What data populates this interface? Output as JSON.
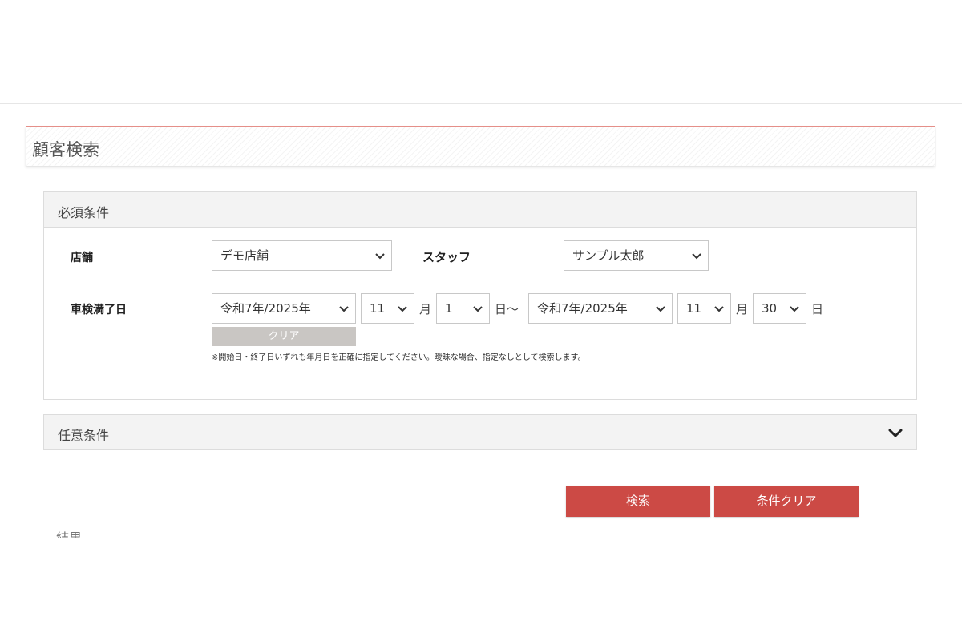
{
  "page": {
    "title": "顧客検索"
  },
  "required": {
    "title": "必須条件",
    "store_label": "店舗",
    "store_value": "デモ店舗",
    "staff_label": "スタッフ",
    "staff_value": "サンプル太郎",
    "date_label": "車検満了日",
    "from": {
      "era": "令和7年/2025年",
      "month": "11",
      "day": "1"
    },
    "to": {
      "era": "令和7年/2025年",
      "month": "11",
      "day": "30"
    },
    "month_unit": "月",
    "day_unit": "日",
    "range_sep": "日～",
    "clear_small": "クリア",
    "note": "※開始日・終了日いずれも年月日を正確に指定してください。曖昧な場合、指定なしとして検索します。"
  },
  "optional": {
    "title": "任意条件"
  },
  "actions": {
    "search": "検索",
    "clear_conditions": "条件クリア"
  },
  "results": {
    "label": "結果"
  },
  "colors": {
    "accent": "#cc4a45",
    "header_border": "#e58f89",
    "mini_button": "#c9c6c3"
  },
  "icons": {
    "select_arrow": "chevron-down-icon",
    "expand": "chevron-down-icon"
  }
}
